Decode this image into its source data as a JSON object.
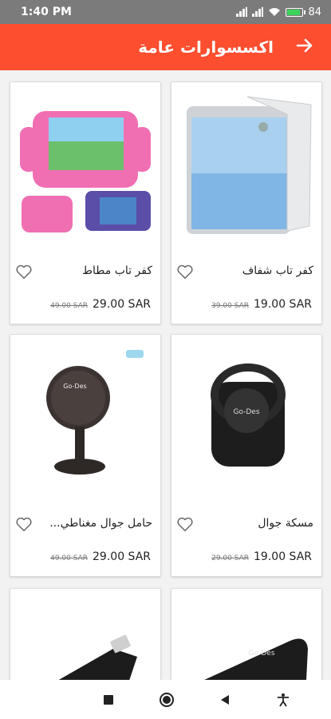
{
  "status": {
    "time": "1:40 PM",
    "battery": "84"
  },
  "header": {
    "title": "اكسسوارات عامة",
    "back_icon": "arrow-right-icon"
  },
  "products": [
    {
      "name": "كفر تاب شفاف",
      "old_price": "39.00 SAR",
      "price": "19.00 SAR",
      "image": "clear-tablet-case"
    },
    {
      "name": "كفر تاب مطاط",
      "old_price": "49.00 SAR",
      "price": "29.00 SAR",
      "image": "kids-rubber-tablet-case"
    },
    {
      "name": "مسكة جوال",
      "old_price": "29.00 SAR",
      "price": "19.00 SAR",
      "image": "phone-ring-holder",
      "image_label": "Go-Des"
    },
    {
      "name": "حامل جوال مغناطي...",
      "old_price": "49.00 SAR",
      "price": "29.00 SAR",
      "image": "magnetic-phone-mount",
      "image_label": "Go-Des"
    },
    {
      "name": "",
      "old_price": "",
      "price": "",
      "image": "dashboard-mount",
      "image_label": "Go-Des"
    },
    {
      "name": "",
      "old_price": "",
      "price": "",
      "image": "lightning-adapter"
    }
  ],
  "navbar": {
    "icons": [
      "recents-square-icon",
      "home-circle-icon",
      "back-triangle-icon",
      "accessibility-icon"
    ]
  },
  "colors": {
    "primary": "#fd4e2f",
    "status_bar": "#7b7b7b",
    "battery": "#3cd35b"
  }
}
